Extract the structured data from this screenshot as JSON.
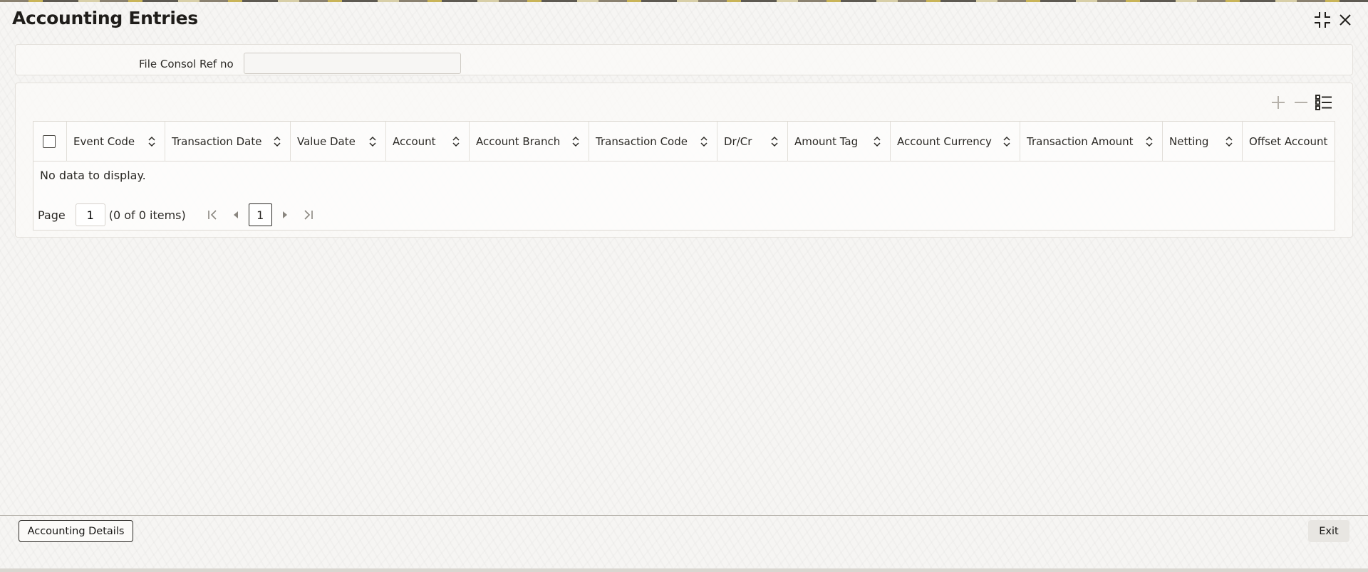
{
  "window": {
    "title": "Accounting Entries"
  },
  "criteria": {
    "file_consol_ref_label": "File Consol Ref no",
    "file_consol_ref_value": ""
  },
  "table": {
    "columns": [
      {
        "label": "Event Code"
      },
      {
        "label": "Transaction Date"
      },
      {
        "label": "Value Date"
      },
      {
        "label": "Account"
      },
      {
        "label": "Account Branch"
      },
      {
        "label": "Transaction Code"
      },
      {
        "label": "Dr/Cr"
      },
      {
        "label": "Amount Tag"
      },
      {
        "label": "Account Currency"
      },
      {
        "label": "Transaction Amount"
      },
      {
        "label": "Netting"
      },
      {
        "label": "Offset Account"
      }
    ],
    "empty_message": "No data to display."
  },
  "pagination": {
    "page_label": "Page",
    "page_value": "1",
    "items_summary": "(0 of 0 items)",
    "current_page": "1"
  },
  "footer": {
    "accounting_details_label": "Accounting Details",
    "exit_label": "Exit"
  }
}
